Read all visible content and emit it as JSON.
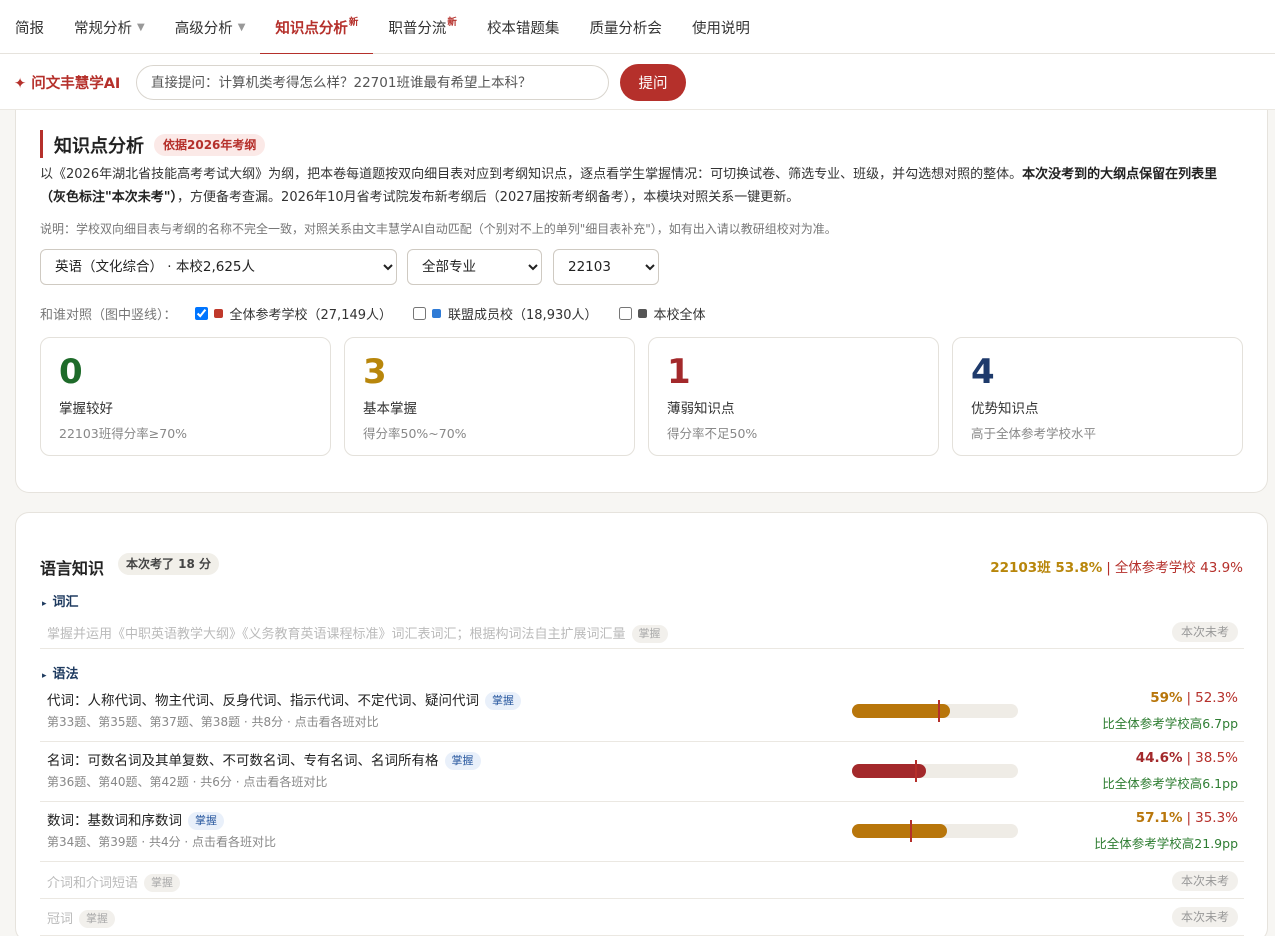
{
  "nav": {
    "items": [
      {
        "label": "简报",
        "caret": "",
        "sup": ""
      },
      {
        "label": "常规分析",
        "caret": "▼",
        "sup": ""
      },
      {
        "label": "高级分析",
        "caret": "▼",
        "sup": ""
      },
      {
        "label": "知识点分析",
        "caret": "",
        "sup": "新"
      },
      {
        "label": "职普分流",
        "caret": "",
        "sup": "新"
      },
      {
        "label": "校本错题集",
        "caret": "",
        "sup": ""
      },
      {
        "label": "质量分析会",
        "caret": "",
        "sup": ""
      },
      {
        "label": "使用说明",
        "caret": "",
        "sup": ""
      }
    ],
    "active_index": 3
  },
  "ai": {
    "brand": "✦ 问文丰慧学AI",
    "placeholder": "直接提问：计算机类考得怎么样？22701班谁最有希望上本科？",
    "ask_label": "提问"
  },
  "overview": {
    "title": "知识点分析",
    "badge": "依据2026年考纲",
    "intro_plain": "以《2026年湖北省技能高考考试大纲》为纲，把本卷每道题按双向细目表对应到考纲知识点，逐点看学生掌握情况：可切换试卷、筛选专业、班级，并勾选想对照的整体。",
    "intro_bold": "本次没考到的大纲点保留在列表里（灰色标注\"本次未考\"）",
    "intro_tail": "，方便备考查漏。2026年10月省考试院发布新考纲后（2027届按新考纲备考），本模块对照关系一键更新。",
    "note": "说明：学校双向细目表与考纲的名称不完全一致，对照关系由文丰慧学AI自动匹配（个别对不上的单列\"细目表补充\"），如有出入请以教研组校对为准。",
    "filters": {
      "paper": "英语（文化综合） · 本校2,625人",
      "major": "全部专业",
      "class": "22103"
    },
    "compare_label": "和谁对照（图中竖线）：",
    "compare": [
      {
        "label": "全体参考学校（27,149人）",
        "color": "#c0392b",
        "checked": true
      },
      {
        "label": "联盟成员校（18,930人）",
        "color": "#2f7bd6",
        "checked": false
      },
      {
        "label": "本校全体",
        "color": "#555555",
        "checked": false
      }
    ]
  },
  "stats": [
    {
      "value": "0",
      "label": "掌握较好",
      "sub": "22103班得分率≥70%",
      "color": "#1e6b2a"
    },
    {
      "value": "3",
      "label": "基本掌握",
      "sub": "得分率50%~70%",
      "color": "#b8860b"
    },
    {
      "value": "1",
      "label": "薄弱知识点",
      "sub": "得分率不足50%",
      "color": "#a3292b"
    },
    {
      "value": "4",
      "label": "优势知识点",
      "sub": "高于全体参考学校水平",
      "color": "#1e3a6b"
    }
  ],
  "section": {
    "title": "语言知识",
    "badge": "本次考了 18 分",
    "class_score": "22103班 53.8%",
    "sep": "|",
    "all_score": "全体参考学校 43.9%",
    "groups": {
      "vocab": "词汇",
      "grammar": "语法"
    },
    "vocab_item": {
      "text": "掌握并运用《中职英语教学大纲》《义务教育英语课程标准》词汇表词汇；根据构词法自主扩展词汇量",
      "pill": "掌握",
      "absent": "本次未考"
    },
    "items": [
      {
        "name": "代词：人称代词、物主代词、反身代词、指示代词、不定代词、疑问代词",
        "pill": "掌握",
        "meta": "第33题、第35题、第37题、第38题 · 共8分 · 点击看各班对比",
        "class_pct": 59,
        "all_pct": 52.3,
        "class_label": "59%",
        "all_label": "52.3%",
        "diff": "比全体参考学校高6.7pp",
        "color": "#b8760b"
      },
      {
        "name": "名词：可数名词及其单复数、不可数名词、专有名词、名词所有格",
        "pill": "掌握",
        "meta": "第36题、第40题、第42题 · 共6分 · 点击看各班对比",
        "class_pct": 44.6,
        "all_pct": 38.5,
        "class_label": "44.6%",
        "all_label": "38.5%",
        "diff": "比全体参考学校高6.1pp",
        "color": "#a3292b"
      },
      {
        "name": "数词：基数词和序数词",
        "pill": "掌握",
        "meta": "第34题、第39题 · 共4分 · 点击看各班对比",
        "class_pct": 57.1,
        "all_pct": 35.3,
        "class_label": "57.1%",
        "all_label": "35.3%",
        "diff": "比全体参考学校高21.9pp",
        "color": "#b8760b"
      }
    ],
    "absent_items": [
      {
        "text": "介词和介词短语",
        "pill": "掌握",
        "absent": "本次未考"
      },
      {
        "text": "冠词",
        "pill": "掌握",
        "absent": "本次未考"
      }
    ]
  }
}
